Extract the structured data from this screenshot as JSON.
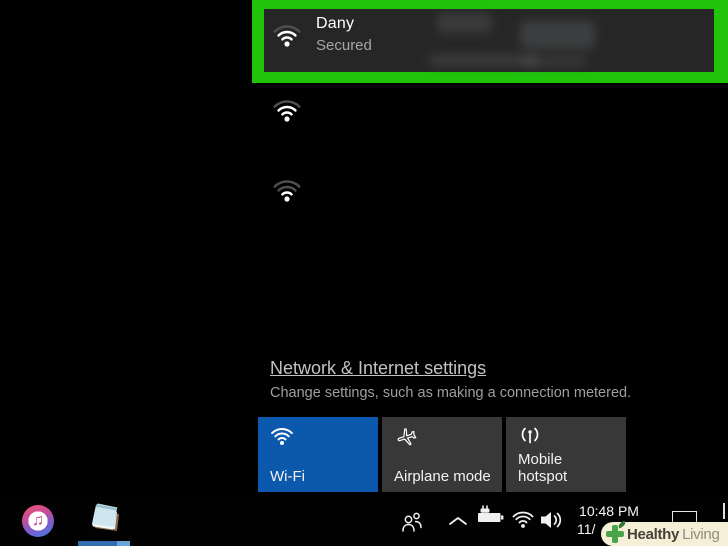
{
  "colors": {
    "highlight_green": "#1fc40b",
    "tile_blue": "#0b58ad",
    "tile_gray": "#383838",
    "item_bg": "#262626",
    "watermark_green": "#4aa54a"
  },
  "wifi_panel": {
    "connected": {
      "name": "Dany",
      "status": "Secured",
      "signal_bars": "2-of-3"
    },
    "other_networks": [
      {
        "signal_bars": "2-of-3"
      },
      {
        "signal_bars": "1-of-3"
      }
    ],
    "settings_link": "Network & Internet settings",
    "settings_hint": "Change settings, such as making a connection metered.",
    "quick_actions": [
      {
        "label": "Wi-Fi",
        "active": true
      },
      {
        "label": "Airplane mode",
        "active": false
      },
      {
        "label": "Mobile hotspot",
        "active": false
      }
    ]
  },
  "taskbar": {
    "clock_time": "10:48 PM",
    "clock_date": "11/",
    "itunes_note": "♫"
  },
  "watermark": {
    "word1": "Healthy",
    "word2": "Living"
  },
  "icons": [
    "wifi-signal-icon",
    "airplane-icon",
    "mobile-hotspot-icon",
    "itunes-icon",
    "notepad-icon",
    "people-icon",
    "chevron-up-icon",
    "battery-charging-icon",
    "wifi-tray-icon",
    "volume-icon",
    "action-center-icon",
    "healthy-living-cross-icon"
  ]
}
